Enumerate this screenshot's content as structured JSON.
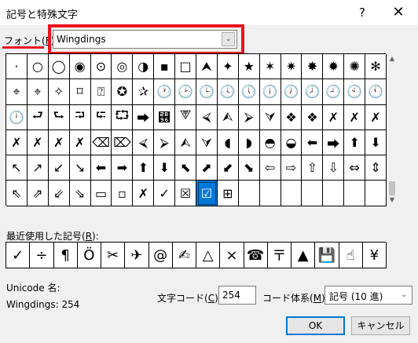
{
  "window": {
    "title": "記号と特殊文字",
    "help_icon": "?",
    "close_icon": "✕"
  },
  "font": {
    "label": "フォント(F):",
    "label_prefix": "フォント(",
    "label_key": "F",
    "label_suffix": ")",
    "selected": "Wingdings",
    "dropdown_icon": "chevron-down-icon",
    "dropdown_glyph": "⌄",
    "highlight_color": "#e8141f"
  },
  "symbol_grid": {
    "rows": [
      [
        "·",
        "○",
        "◯",
        "◉",
        "⊙",
        "◎",
        "◑",
        "▪",
        "□",
        "⮝",
        "✦",
        "★",
        "✶",
        "✷",
        "✸",
        "✹",
        "✺",
        "✻"
      ],
      [
        "⌖",
        "⌖",
        "✧",
        "⌑",
        "⍰",
        "✪",
        "✰",
        "🕐",
        "🕑",
        "🕒",
        "🕓",
        "🕔",
        "🕕",
        "🕖",
        "🕗",
        "🕘",
        "🕙",
        "🕚"
      ],
      [
        "🕛",
        "⮐",
        "⮑",
        "⮒",
        "⮓",
        "⮔",
        "⮕",
        "⮖",
        "⮗",
        "⮘",
        "⮙",
        "⮚",
        "⮛",
        "❖",
        "❖",
        "✗",
        "✗",
        "✗"
      ],
      [
        "✗",
        "✗",
        "✗",
        "✗",
        "⌫",
        "⌦",
        "⮘",
        "⮚",
        "⮙",
        "⮛",
        "◖",
        "◗",
        "◓",
        "◒",
        "⬅",
        "⮕",
        "⬆",
        "⬇"
      ],
      [
        "↖",
        "↗",
        "↙",
        "↘",
        "⬅",
        "➡",
        "⬆",
        "⬇",
        "⬉",
        "⬈",
        "⬋",
        "⬊",
        "⇦",
        "⇨",
        "⇧",
        "⇩",
        "⇔",
        "⇕"
      ],
      [
        "⇖",
        "⇗",
        "⇙",
        "⇘",
        "▭",
        "▫",
        "✗",
        "✓",
        "☒",
        "☑",
        "⊞",
        "",
        "",
        "",
        "",
        "",
        "",
        ""
      ]
    ],
    "selected_row": 5,
    "selected_col": 9,
    "selected_color": "#0078d7"
  },
  "recent": {
    "label": "最近使用した記号(R):",
    "label_prefix": "最近使用した記号(",
    "label_key": "R",
    "label_suffix": "):",
    "symbols": [
      "✓",
      "÷",
      "¶",
      "Ö",
      "✂",
      "✈",
      "@",
      "✍",
      "△",
      "×",
      "☎",
      "〒",
      "▲",
      "💾",
      "☝",
      "¥"
    ]
  },
  "info": {
    "unicode_name_label": "Unicode 名:",
    "char_name": "Wingdings: 254"
  },
  "code": {
    "label_prefix": "文字コード(",
    "label_key": "C",
    "label_suffix": "):",
    "value": "254",
    "system_label_prefix": "コード体系(",
    "system_label_key": "M",
    "system_label_suffix": "):",
    "system_value": "記号 (10 進)",
    "system_dropdown_icon": "chevron-down-icon",
    "system_dropdown_glyph": "⌄"
  },
  "buttons": {
    "ok": "OK",
    "cancel": "キャンセル"
  },
  "scrollbar": {
    "up_glyph": "▲",
    "down_glyph": "▼"
  }
}
